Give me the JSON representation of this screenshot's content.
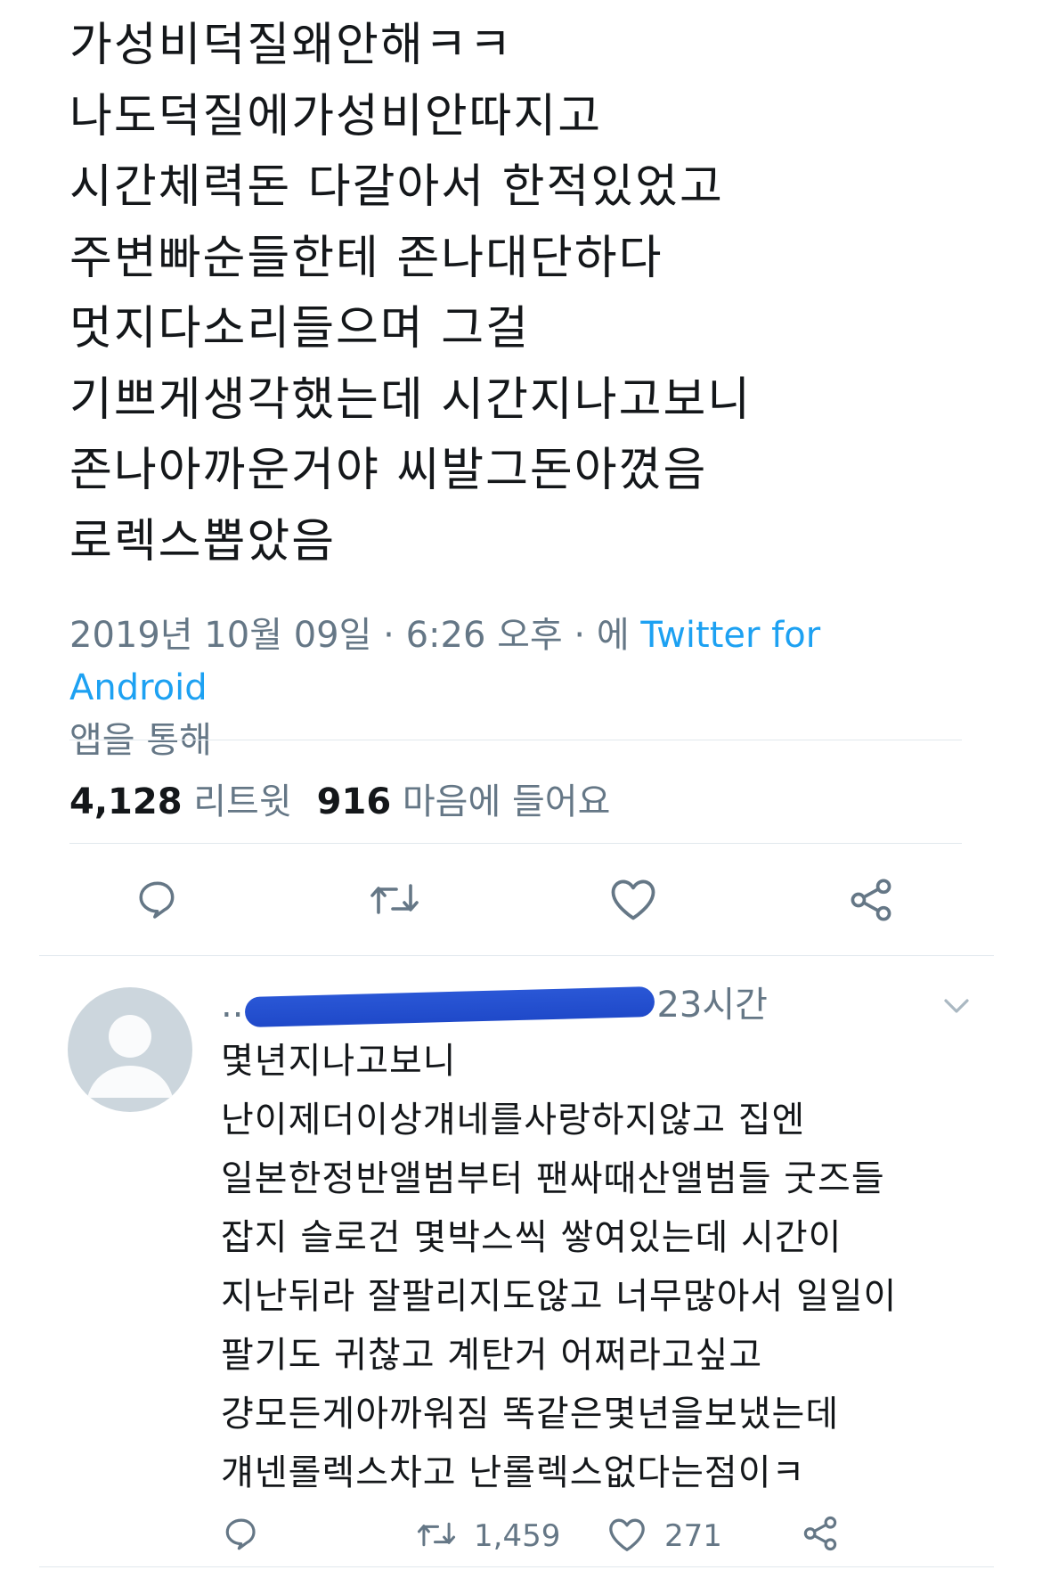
{
  "tweet": {
    "lines": [
      "가성비덕질왜안해ㅋㅋ",
      "나도덕질에가성비안따지고",
      "시간체력돈 다갈아서 한적있었고",
      "주변빠순들한테 존나대단하다",
      "멋지다소리들으며 그걸",
      "기쁘게생각했는데 시간지나고보니",
      "존나아까운거야 씨발그돈아꼈음",
      "로렉스뽑았음"
    ],
    "timestamp_prefix": "2019년 10월 09일 · 6:26 오후 · 에 ",
    "source_link": "Twitter for Android",
    "source_suffix": " 앱을 통해",
    "retweet_count": "4,128",
    "retweet_label": "리트윗",
    "like_count": "916",
    "like_label": "마음에 들어요"
  },
  "reply": {
    "handle_start": "..",
    "time": "23시간",
    "lines": [
      "몇년지나고보니",
      "난이제더이상걔네를사랑하지않고 집엔",
      "일본한정반앨범부터 팬싸때산앨범들 굿즈들",
      "잡지 슬로건 몇박스씩 쌓여있는데 시간이",
      "지난뒤라 잘팔리지도않고 너무많아서 일일이",
      "팔기도 귀찮고 계탄거 어쩌라고싶고",
      "걍모든게아까워짐 똑같은몇년을보냈는데",
      "걔넨롤렉스차고 난롤렉스없다는점이ㅋ"
    ],
    "retweet_count": "1,459",
    "like_count": "271"
  },
  "icons": {
    "reply": "reply-icon",
    "retweet": "retweet-icon",
    "like": "heart-icon",
    "share": "share-icon",
    "caret": "chevron-down-icon",
    "avatar": "default-avatar-icon"
  },
  "colors": {
    "text": "#14171a",
    "secondary": "#657786",
    "link": "#1da1f2",
    "divider": "#e1e8ed",
    "avatar_bg": "#ccd6dd"
  }
}
